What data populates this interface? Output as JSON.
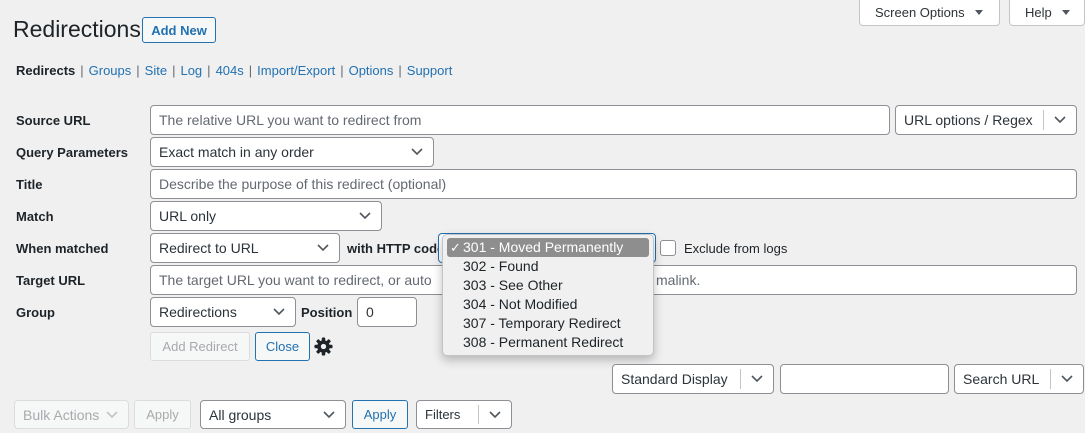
{
  "top_tabs": {
    "screen_options": "Screen Options",
    "help": "Help"
  },
  "header": {
    "title": "Redirections",
    "add_new": "Add New"
  },
  "subnav": {
    "current": "Redirects",
    "items": [
      "Groups",
      "Site",
      "Log",
      "404s",
      "Import/Export",
      "Options",
      "Support"
    ]
  },
  "form": {
    "source_url": {
      "label": "Source URL",
      "placeholder": "The relative URL you want to redirect from",
      "options_select": "URL options / Regex"
    },
    "query_parameters": {
      "label": "Query Parameters",
      "value": "Exact match in any order"
    },
    "title": {
      "label": "Title",
      "placeholder": "Describe the purpose of this redirect (optional)"
    },
    "match": {
      "label": "Match",
      "value": "URL only"
    },
    "when_matched": {
      "label": "When matched",
      "action": "Redirect to URL",
      "http_code_label": "with HTTP code",
      "exclude_label": "Exclude from logs"
    },
    "target_url": {
      "label": "Target URL",
      "placeholder_left": "The target URL you want to redirect, or auto",
      "placeholder_right": "malink."
    },
    "group": {
      "label": "Group",
      "value": "Redirections",
      "position_label": "Position",
      "position_value": "0"
    },
    "add_redirect": "Add Redirect",
    "close": "Close"
  },
  "http_code_dropdown": {
    "selected_index": 0,
    "options": [
      "301 - Moved Permanently",
      "302 - Found",
      "303 - See Other",
      "304 - Not Modified",
      "307 - Temporary Redirect",
      "308 - Permanent Redirect"
    ]
  },
  "table_controls": {
    "display_select": "Standard Display",
    "search_value": "",
    "search_select": "Search URL",
    "bulk_actions": "Bulk Actions",
    "apply_disabled": "Apply",
    "groups_select": "All groups",
    "apply": "Apply",
    "filters": "Filters"
  },
  "colors": {
    "accent": "#2271b1",
    "background": "#f0f0f1",
    "text": "#1d2327"
  }
}
